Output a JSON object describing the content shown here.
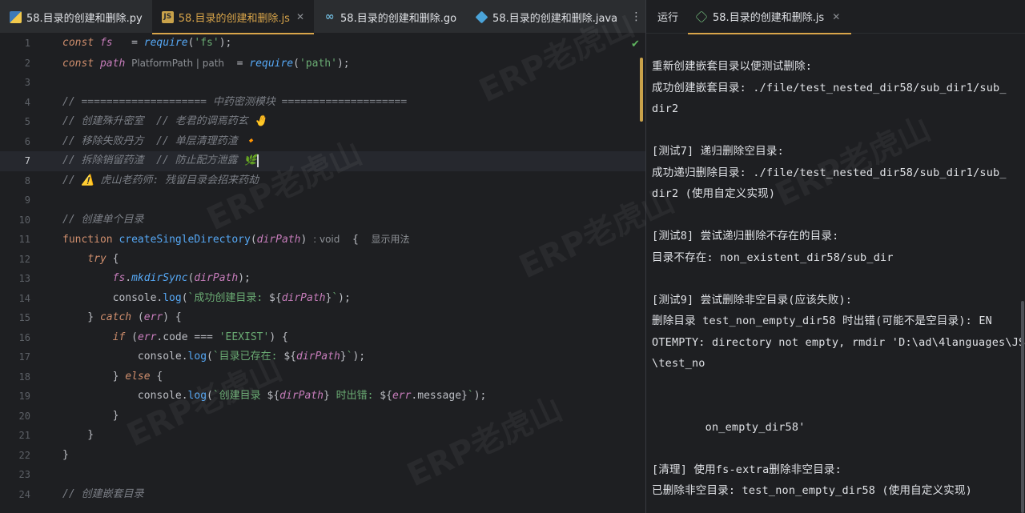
{
  "editor": {
    "tabs": [
      {
        "label": "58.目录的创建和删除.py",
        "icon": "python-icon",
        "active": false
      },
      {
        "label": "58.目录的创建和删除.js",
        "icon": "javascript-icon",
        "active": true
      },
      {
        "label": "58.目录的创建和删除.go",
        "icon": "go-icon",
        "active": false
      },
      {
        "label": "58.目录的创建和删除.java",
        "icon": "java-icon",
        "active": false
      }
    ],
    "more_icon": "⋮",
    "close_glyph": "✕",
    "current_line": 7,
    "lines": [
      {
        "no": "1",
        "html": "<span class=\"kw\">const</span> <span class=\"va\">fs</span>   <span class=\"pr\">=</span> <span class=\"fni\">require</span>(<span class=\"st\">'fs'</span>);"
      },
      {
        "no": "2",
        "html": "<span class=\"kw\">const</span> <span class=\"va\">path</span> <span class=\"hint\">PlatformPath | path</span>  = <span class=\"fni\">require</span>(<span class=\"st\">'path'</span>);"
      },
      {
        "no": "3",
        "html": ""
      },
      {
        "no": "4",
        "html": "<span class=\"cm\">// ==================== 中药密测模块 ====================</span>"
      },
      {
        "no": "5",
        "html": "<span class=\"cm\">// 创建殊升密室  // 老君的调焉药玄 🤚</span>"
      },
      {
        "no": "6",
        "html": "<span class=\"cm\">// 移除失败丹方  // 单层清理药渣 🔸</span>"
      },
      {
        "no": "7",
        "html": "<span class=\"cm\">// 拆除销留药渣  // 防止配方泄露 🌿</span>"
      },
      {
        "no": "8",
        "html": "<span class=\"cm\">// ⚠️ 虎山老药师: 残留目录会招来药劫</span>"
      },
      {
        "no": "10",
        "html": "<span class=\"cm\">// 创建单个目录</span>"
      },
      {
        "no": "11",
        "html": "<span class=\"kwn\">function</span> <span class=\"fn\">createSingleDirectory</span>(<span class=\"va\">dirPath</span>) <span class=\"hint\">: void</span>  {  <span class=\"hint\">显示用法</span>"
      },
      {
        "no": "12",
        "html": "    <span class=\"kw\">try</span> {"
      },
      {
        "no": "13",
        "html": "        <span class=\"va\">fs</span>.<span class=\"fni\">mkdirSync</span>(<span class=\"va\">dirPath</span>);"
      },
      {
        "no": "14",
        "html": "        console.<span class=\"fn\">log</span>(<span class=\"st\">`成功创建目录: </span>${<span class=\"tpl\">dirPath</span>}<span class=\"st\">`</span>);"
      },
      {
        "no": "15",
        "html": "    } <span class=\"kw\">catch</span> (<span class=\"va\">err</span>) {"
      },
      {
        "no": "16",
        "html": "        <span class=\"kw\">if</span> (<span class=\"va\">err</span>.code === <span class=\"st\">'EEXIST'</span>) {"
      },
      {
        "no": "17",
        "html": "            console.<span class=\"fn\">log</span>(<span class=\"st\">`目录已存在: </span>${<span class=\"tpl\">dirPath</span>}<span class=\"st\">`</span>);"
      },
      {
        "no": "18",
        "html": "        } <span class=\"kw\">else</span> {"
      },
      {
        "no": "19",
        "html": "            console.<span class=\"fn\">log</span>(<span class=\"st\">`创建目录 </span>${<span class=\"tpl\">dirPath</span>}<span class=\"st\"> 时出错: </span>${<span class=\"tpl\">err</span>.message}<span class=\"st\">`</span>);"
      },
      {
        "no": "20",
        "html": "        }"
      },
      {
        "no": "21",
        "html": "    }"
      },
      {
        "no": "22",
        "html": "}"
      },
      {
        "no": "23",
        "html": ""
      },
      {
        "no": "24",
        "html": "<span class=\"cm\">// 创建嵌套目录</span>"
      }
    ]
  },
  "run_panel": {
    "title": "运行",
    "tab_label": "58.目录的创建和删除.js",
    "tab_icon": "nodejs-icon",
    "output": [
      "重新创建嵌套目录以便测试删除:",
      "成功创建嵌套目录: ./file/test_nested_dir58/sub_dir1/sub_",
      "dir2",
      "",
      "[测试7] 递归删除空目录:",
      "成功递归删除目录: ./file/test_nested_dir58/sub_dir1/sub_",
      "dir2 (使用自定义实现)",
      "",
      "[测试8] 尝试递归删除不存在的目录:",
      "目录不存在: non_existent_dir58/sub_dir",
      "",
      "[测试9] 尝试删除非空目录(应该失败):",
      "删除目录 test_non_empty_dir58 时出错(可能不是空目录): EN",
      "OTEMPTY: directory not empty, rmdir 'D:\\ad\\4languages\\JS",
      "\\test_no",
      "",
      "",
      "        on_empty_dir58'",
      "",
      "[清理] 使用fs-extra删除非空目录:",
      "已删除非空目录: test_non_empty_dir58 (使用自定义实现)"
    ]
  },
  "watermark": "ERP老虎山"
}
